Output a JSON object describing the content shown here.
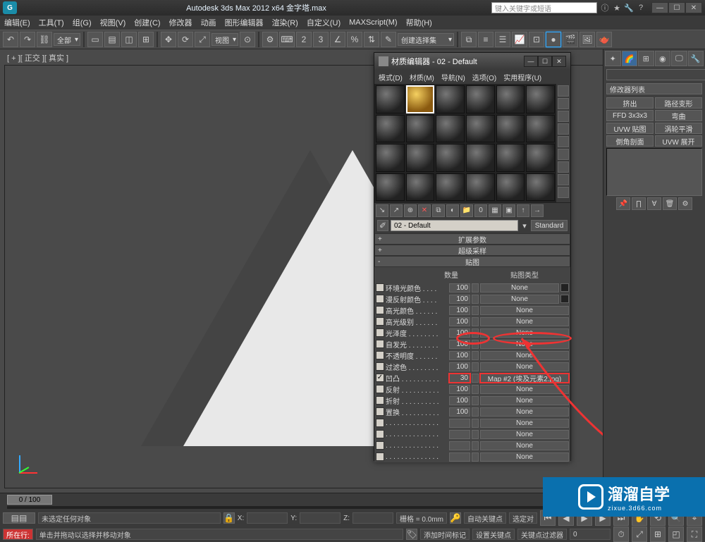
{
  "title": "Autodesk 3ds Max 2012 x64    金字塔.max",
  "search_placeholder": "键入关键字或短语",
  "menus": [
    "编辑(E)",
    "工具(T)",
    "组(G)",
    "视图(V)",
    "创建(C)",
    "修改器",
    "动画",
    "图形编辑器",
    "渲染(R)",
    "自定义(U)",
    "MAXScript(M)",
    "帮助(H)"
  ],
  "toolbar": {
    "scope": "全部",
    "view": "视图",
    "selmode": "创建选择集"
  },
  "viewport_label": "[ + ][ 正交 ][ 真实 ]",
  "mat_editor": {
    "title": "材质编辑器 - 02 - Default",
    "menus": [
      "模式(D)",
      "材质(M)",
      "导航(N)",
      "选项(O)",
      "实用程序(U)"
    ],
    "name": "02 - Default",
    "type": "Standard",
    "rollouts": {
      "r1": "扩展参数",
      "r2": "超级采样",
      "r3": "贴图"
    },
    "map_headers": {
      "amount": "数量",
      "type": "贴图类型"
    },
    "maps": [
      {
        "lbl": "环境光颜色 . . . .",
        "v": "100",
        "btn": "None",
        "chk": false
      },
      {
        "lbl": "漫反射颜色 . . . .",
        "v": "100",
        "btn": "None",
        "chk": false
      },
      {
        "lbl": "高光颜色 . . . . . .",
        "v": "100",
        "btn": "None",
        "chk": false
      },
      {
        "lbl": "高光级别 . . . . . .",
        "v": "100",
        "btn": "None",
        "chk": false
      },
      {
        "lbl": "光泽度 . . . . . . . .",
        "v": "100",
        "btn": "None",
        "chk": false
      },
      {
        "lbl": "自发光 . . . . . . . .",
        "v": "100",
        "btn": "None",
        "chk": false
      },
      {
        "lbl": "不透明度 . . . . . .",
        "v": "100",
        "btn": "None",
        "chk": false
      },
      {
        "lbl": "过滤色 . . . . . . . .",
        "v": "100",
        "btn": "None",
        "chk": false
      },
      {
        "lbl": "凹凸 . . . . . . . . . .",
        "v": "30",
        "btn": "Map #2 (埃及元素2.jpg)",
        "chk": true
      },
      {
        "lbl": "反射 . . . . . . . . . .",
        "v": "100",
        "btn": "None",
        "chk": false
      },
      {
        "lbl": "折射 . . . . . . . . . .",
        "v": "100",
        "btn": "None",
        "chk": false
      },
      {
        "lbl": "置换 . . . . . . . . . .",
        "v": "100",
        "btn": "None",
        "chk": false
      },
      {
        "lbl": ". . . . . . . . . . . . . .",
        "v": "",
        "btn": "None",
        "chk": false
      },
      {
        "lbl": ". . . . . . . . . . . . . .",
        "v": "",
        "btn": "None",
        "chk": false
      },
      {
        "lbl": ". . . . . . . . . . . . . .",
        "v": "",
        "btn": "None",
        "chk": false
      },
      {
        "lbl": ". . . . . . . . . . . . . .",
        "v": "",
        "btn": "None",
        "chk": false
      }
    ]
  },
  "cmd": {
    "list_label": "修改器列表",
    "mods": [
      "挤出",
      "路径变形",
      "FFD 3x3x3",
      "弯曲",
      "UVW 贴图",
      "涡轮平滑",
      "倒角剖面",
      "UVW 展开"
    ]
  },
  "time": {
    "slider": "0 / 100"
  },
  "status": {
    "sel": "未选定任何对象",
    "x": "X:",
    "y": "Y:",
    "z": "Z:",
    "grid": "栅格 = 0.0mm",
    "autokey": "自动关键点",
    "selset": "选定对"
  },
  "bottom": {
    "row_label": "所在行:",
    "hint": "单击并拖动以选择并移动对象",
    "addtime": "添加时间标记",
    "setkey": "设置关键点",
    "keyfilter": "关键点过滤器"
  },
  "watermark": {
    "brand": "溜溜自学",
    "url": "zixue.3d66.com"
  }
}
